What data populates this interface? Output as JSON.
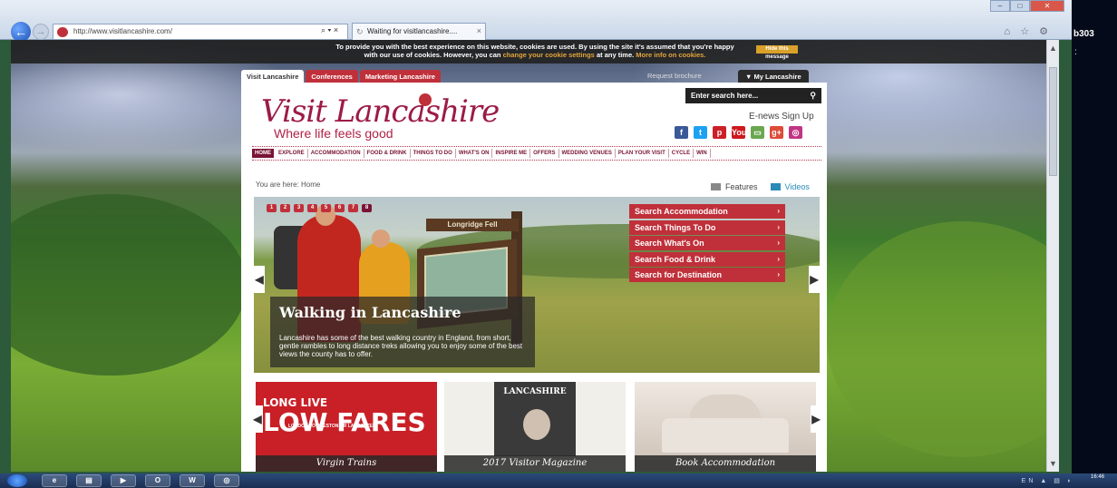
{
  "browser": {
    "url": "http://www.visitlancashire.com/",
    "address_controls": "⌕ ▾ ×",
    "tab_title": "Waiting for visitlancashire....",
    "tab_close": "×",
    "win_min": "–",
    "win_max": "□",
    "win_close": "✕",
    "tool_icons": "⌂ ☆ ⚙"
  },
  "right_strip": {
    "text": "b303",
    "colon": ":"
  },
  "cookie": {
    "line1": "To provide you with the best experience on this website, cookies are used. By using the site it's assumed that you're happy",
    "line2_pre": "with our use of cookies. However, you can",
    "link1": "change your cookie settings",
    "line2_mid": "at any time.",
    "link2": "More info on cookies.",
    "hide_button": "Hide this message"
  },
  "site_tabs": [
    "Visit Lancashire",
    "Conferences",
    "Marketing Lancashire"
  ],
  "request_brochure": "Request brochure",
  "my_lancashire": "My Lancashire",
  "logo": {
    "text": "Visit Lancashire",
    "tagline": "Where life feels good"
  },
  "search_placeholder": "Enter search here...",
  "enews": "E-news Sign Up",
  "socials": [
    "f",
    "t",
    "p",
    "You",
    "▭",
    "g+",
    "◎"
  ],
  "social_colors": [
    "#3b5998",
    "#1da1f2",
    "#cb2027",
    "#cc181e",
    "#6aa84f",
    "#dd4b39",
    "#c13584"
  ],
  "nav": [
    "HOME",
    "EXPLORE",
    "ACCOMMODATION",
    "FOOD & DRINK",
    "THINGS TO DO",
    "WHAT'S ON",
    "INSPIRE ME",
    "OFFERS",
    "WEDDING VENUES",
    "PLAN YOUR VISIT",
    "CYCLE",
    "WIN"
  ],
  "breadcrumb": "You are here: Home",
  "view_toggle": {
    "features": "Features",
    "videos": "Videos"
  },
  "slider": {
    "dots": [
      "1",
      "2",
      "3",
      "4",
      "5",
      "6",
      "7",
      "8"
    ],
    "active_dot": 8,
    "signpost": "Longridge Fell",
    "title": "Walking in Lancashire",
    "description": "Lancashire has some of the best walking country in England, from short, gentle rambles to long distance treks allowing you to enjoy some of the best views the county has to offer."
  },
  "search_menu": [
    "Search Accommodation",
    "Search Things To Do",
    "Search What's On",
    "Search Food & Drink",
    "Search for Destination"
  ],
  "arrows": {
    "left": "◀",
    "right": "▶",
    "chevron": "›"
  },
  "cards": [
    {
      "label": "Virgin Trains",
      "headline1": "LONG LIVE",
      "headline2": "LOW FARES",
      "sub": "LONDON TO PRESTON OR LANCASTER"
    },
    {
      "label": "2017 Visitor Magazine",
      "cover_title": "LANCASHIRE"
    },
    {
      "label": "Book Accommodation"
    }
  ],
  "taskbar": {
    "apps": [
      "e",
      "▤",
      "▶",
      "O",
      "W",
      "◎"
    ],
    "tray": "EN ▲ ▤ ◗",
    "time": "16:46"
  }
}
